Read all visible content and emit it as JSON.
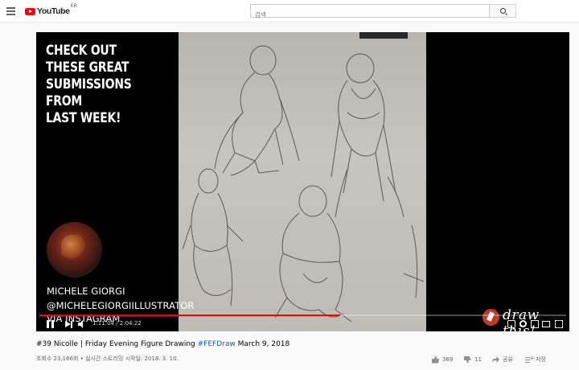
{
  "header": {
    "logo_text": "YouTube",
    "logo_country": "KR",
    "search_placeholder": "검색"
  },
  "player": {
    "overlay_title": "CHECK OUT\nTHESE GREAT\nSUBMISSIONS\nFROM\nLAST WEEK!",
    "credit_name": "MICHELE GIORGI",
    "credit_handle": "@MICHELEGIORGIILLUSTRATOR",
    "credit_via": "VIA INSTAGRAM",
    "brand_text": "draw this!",
    "current_time": "1:11:04",
    "duration": "2:04:22",
    "time_display": "1:11:04 / 2:04:22",
    "played_fraction": 0.571,
    "buffered_fraction": 0.575
  },
  "video": {
    "title_main": "#39 Nicolle | Friday Evening Figure Drawing ",
    "title_tag": "#FEFDraw",
    "title_date": " March 9, 2018",
    "views": "조회수 23,166회 • 실시간 스트리밍 시작일: 2018. 3. 10.",
    "likes": "369",
    "dislikes": "11",
    "share_label": "공유",
    "save_label": "저장"
  }
}
